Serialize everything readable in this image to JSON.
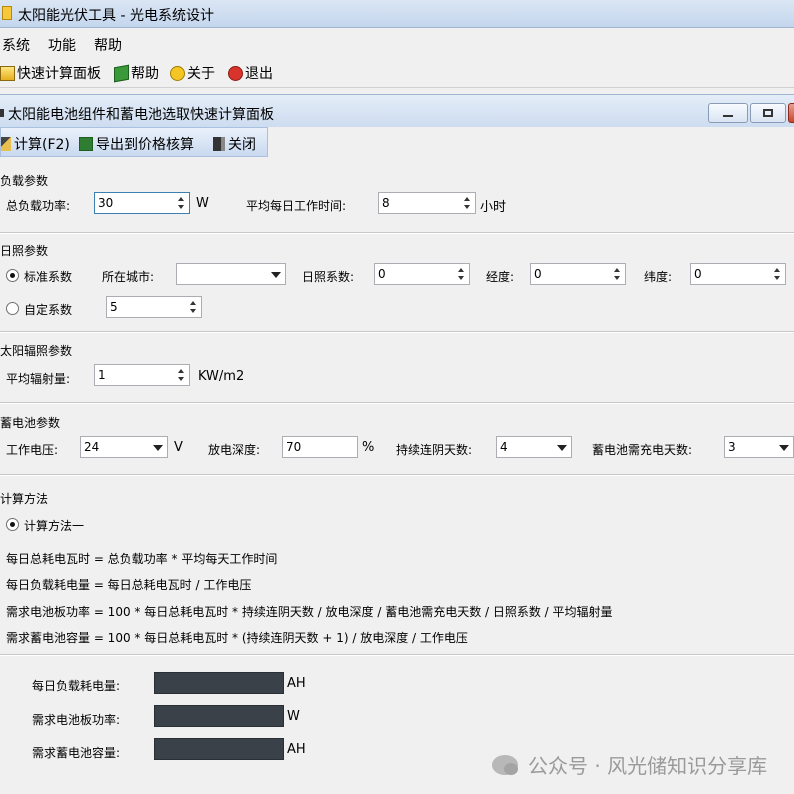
{
  "window": {
    "title": "太阳能光伏工具 - 光电系统设计"
  },
  "menu": {
    "items": [
      "系统",
      "功能",
      "帮助"
    ]
  },
  "toolbar": {
    "items": [
      "快速计算面板",
      "帮助",
      "关于",
      "退出"
    ]
  },
  "panel": {
    "title": "太阳能电池组件和蓄电池选取快速计算面板",
    "tools": [
      "计算(F2)",
      "导出到价格核算",
      "关闭"
    ]
  },
  "load": {
    "section": "负载参数",
    "power_label": "总负载功率:",
    "power_value": "30",
    "power_unit": "W",
    "hours_label": "平均每日工作时间:",
    "hours_value": "8",
    "hours_unit": "小时"
  },
  "sun": {
    "section": "日照参数",
    "standard_label": "标准系数",
    "city_label": "所在城市:",
    "city_value": "",
    "coef_label": "日照系数:",
    "coef_value": "0",
    "lon_label": "经度:",
    "lon_value": "0",
    "lat_label": "纬度:",
    "lat_value": "0",
    "custom_label": "自定系数",
    "custom_value": "5"
  },
  "radiation": {
    "section": "太阳辐照参数",
    "avg_label": "平均辐射量:",
    "avg_value": "1",
    "avg_unit": "KW/m2"
  },
  "battery": {
    "section": "蓄电池参数",
    "voltage_label": "工作电压:",
    "voltage_value": "24",
    "voltage_unit": "V",
    "dod_label": "放电深度:",
    "dod_value": "70",
    "dod_unit": "%",
    "cloudy_label": "持续连阴天数:",
    "cloudy_value": "4",
    "recharge_label": "蓄电池需充电天数:",
    "recharge_value": "3"
  },
  "method": {
    "section": "计算方法",
    "method1_label": "计算方法一",
    "formulas": [
      "每日总耗电瓦时 = 总负载功率 * 平均每天工作时间",
      "每日负载耗电量 = 每日总耗电瓦时 / 工作电压",
      "需求电池板功率 = 100 * 每日总耗电瓦时 * 持续连阴天数 / 放电深度 / 蓄电池需充电天数 / 日照系数 / 平均辐射量",
      "需求蓄电池容量 = 100 * 每日总耗电瓦时 * (持续连阴天数 + 1) / 放电深度 / 工作电压"
    ]
  },
  "results": {
    "daily_label": "每日负载耗电量:",
    "daily_unit": "AH",
    "panel_label": "需求电池板功率:",
    "panel_unit": "W",
    "capacity_label": "需求蓄电池容量:",
    "capacity_unit": "AH"
  },
  "watermark": {
    "text": "公众号 · 风光储知识分享库"
  }
}
